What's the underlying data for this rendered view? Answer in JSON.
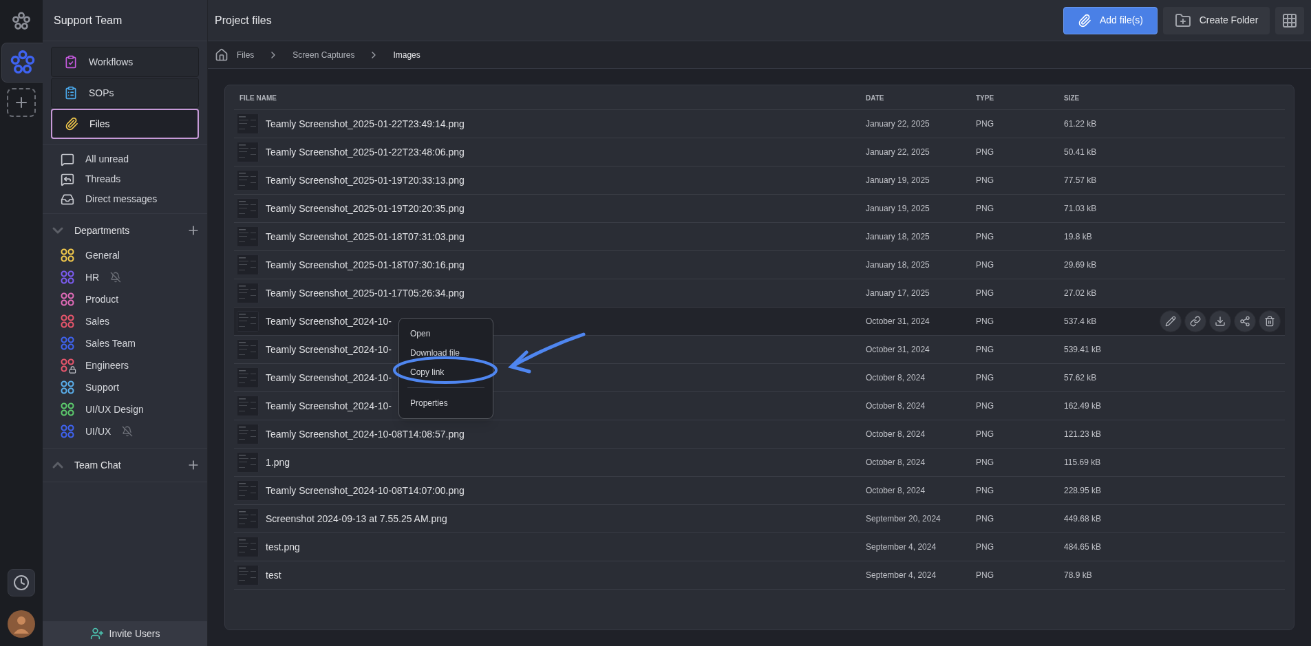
{
  "workspace": {
    "name": "Support Team"
  },
  "nav": [
    {
      "kind": "workflows",
      "label": "Workflows",
      "selected": false
    },
    {
      "kind": "sops",
      "label": "SOPs",
      "selected": false
    },
    {
      "kind": "files",
      "label": "Files",
      "selected": true
    }
  ],
  "quick_links": [
    {
      "kind": "unread",
      "label": "All unread"
    },
    {
      "kind": "threads",
      "label": "Threads"
    },
    {
      "kind": "direct",
      "label": "Direct messages"
    }
  ],
  "sections": [
    {
      "title": "Departments",
      "expanded": true,
      "channels": [
        {
          "name": "General",
          "color": "#f2c94c",
          "muted": false,
          "locked": false
        },
        {
          "name": "HR",
          "color": "#7c5cf2",
          "muted": true,
          "locked": false
        },
        {
          "name": "Product",
          "color": "#e06bb8",
          "muted": false,
          "locked": false
        },
        {
          "name": "Sales",
          "color": "#e8566c",
          "muted": false,
          "locked": false
        },
        {
          "name": "Sales Team",
          "color": "#3f63f0",
          "muted": false,
          "locked": false
        },
        {
          "name": "Engineers",
          "color": "#e8566c",
          "muted": false,
          "locked": true
        },
        {
          "name": "Support",
          "color": "#5aaeea",
          "muted": false,
          "locked": false
        },
        {
          "name": "UI/UX Design",
          "color": "#5cc96c",
          "muted": false,
          "locked": false
        },
        {
          "name": "UI/UX",
          "color": "#3f63f0",
          "muted": true,
          "locked": false
        }
      ]
    },
    {
      "title": "Team Chat",
      "expanded": false
    }
  ],
  "invite": "Invite Users",
  "page_title": "Project files",
  "buttons": {
    "add": "Add file(s)",
    "create_folder": "Create Folder"
  },
  "breadcrumb": [
    "Files",
    "Screen Captures",
    "Images"
  ],
  "table": {
    "columns": [
      "FILE NAME",
      "DATE",
      "TYPE",
      "SIZE"
    ],
    "rows": [
      {
        "name": "Teamly Screenshot_2025-01-22T23:49:14.png",
        "date": "January 22, 2025",
        "type": "PNG",
        "size": "61.22 kB",
        "selected": false
      },
      {
        "name": "Teamly Screenshot_2025-01-22T23:48:06.png",
        "date": "January 22, 2025",
        "type": "PNG",
        "size": "50.41 kB",
        "selected": false
      },
      {
        "name": "Teamly Screenshot_2025-01-19T20:33:13.png",
        "date": "January 19, 2025",
        "type": "PNG",
        "size": "77.57 kB",
        "selected": false
      },
      {
        "name": "Teamly Screenshot_2025-01-19T20:20:35.png",
        "date": "January 19, 2025",
        "type": "PNG",
        "size": "71.03 kB",
        "selected": false
      },
      {
        "name": "Teamly Screenshot_2025-01-18T07:31:03.png",
        "date": "January 18, 2025",
        "type": "PNG",
        "size": "19.8 kB",
        "selected": false
      },
      {
        "name": "Teamly Screenshot_2025-01-18T07:30:16.png",
        "date": "January 18, 2025",
        "type": "PNG",
        "size": "29.69 kB",
        "selected": false
      },
      {
        "name": "Teamly Screenshot_2025-01-17T05:26:34.png",
        "date": "January 17, 2025",
        "type": "PNG",
        "size": "27.02 kB",
        "selected": false
      },
      {
        "name": "Teamly Screenshot_2024-10-",
        "date": "October 31, 2024",
        "type": "PNG",
        "size": "537.4 kB",
        "selected": true
      },
      {
        "name": "Teamly Screenshot_2024-10-",
        "date": "October 31, 2024",
        "type": "PNG",
        "size": "539.41 kB",
        "selected": false
      },
      {
        "name": "Teamly Screenshot_2024-10-",
        "date": "October 8, 2024",
        "type": "PNG",
        "size": "57.62 kB",
        "selected": false
      },
      {
        "name": "Teamly Screenshot_2024-10-",
        "date": "October 8, 2024",
        "type": "PNG",
        "size": "162.49 kB",
        "selected": false
      },
      {
        "name": "Teamly Screenshot_2024-10-08T14:08:57.png",
        "date": "October 8, 2024",
        "type": "PNG",
        "size": "121.23 kB",
        "selected": false
      },
      {
        "name": "1.png",
        "date": "October 8, 2024",
        "type": "PNG",
        "size": "115.69 kB",
        "selected": false
      },
      {
        "name": "Teamly Screenshot_2024-10-08T14:07:00.png",
        "date": "October 8, 2024",
        "type": "PNG",
        "size": "228.95 kB",
        "selected": false
      },
      {
        "name": "Screenshot 2024-09-13 at 7.55.25 AM.png",
        "date": "September 20, 2024",
        "type": "PNG",
        "size": "449.68 kB",
        "selected": false
      },
      {
        "name": "test.png",
        "date": "September 4, 2024",
        "type": "PNG",
        "size": "484.65 kB",
        "selected": false
      },
      {
        "name": "test",
        "date": "September 4, 2024",
        "type": "PNG",
        "size": "78.9 kB",
        "selected": false
      }
    ]
  },
  "context_menu": {
    "items": [
      "Open",
      "Download file",
      "Copy link",
      "Properties"
    ]
  }
}
